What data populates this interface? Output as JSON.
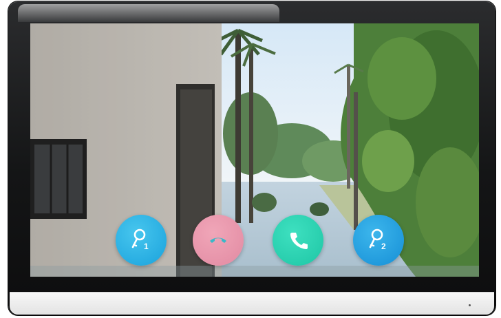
{
  "controls": {
    "unlock_1": {
      "icon": "key-icon",
      "number": "1",
      "color": "#22abe3"
    },
    "hangup": {
      "icon": "phone-hangup-icon",
      "color": "#e892a8"
    },
    "answer": {
      "icon": "phone-answer-icon",
      "color": "#25cdad"
    },
    "unlock_2": {
      "icon": "key-icon",
      "number": "2",
      "color": "#1c9add"
    }
  }
}
